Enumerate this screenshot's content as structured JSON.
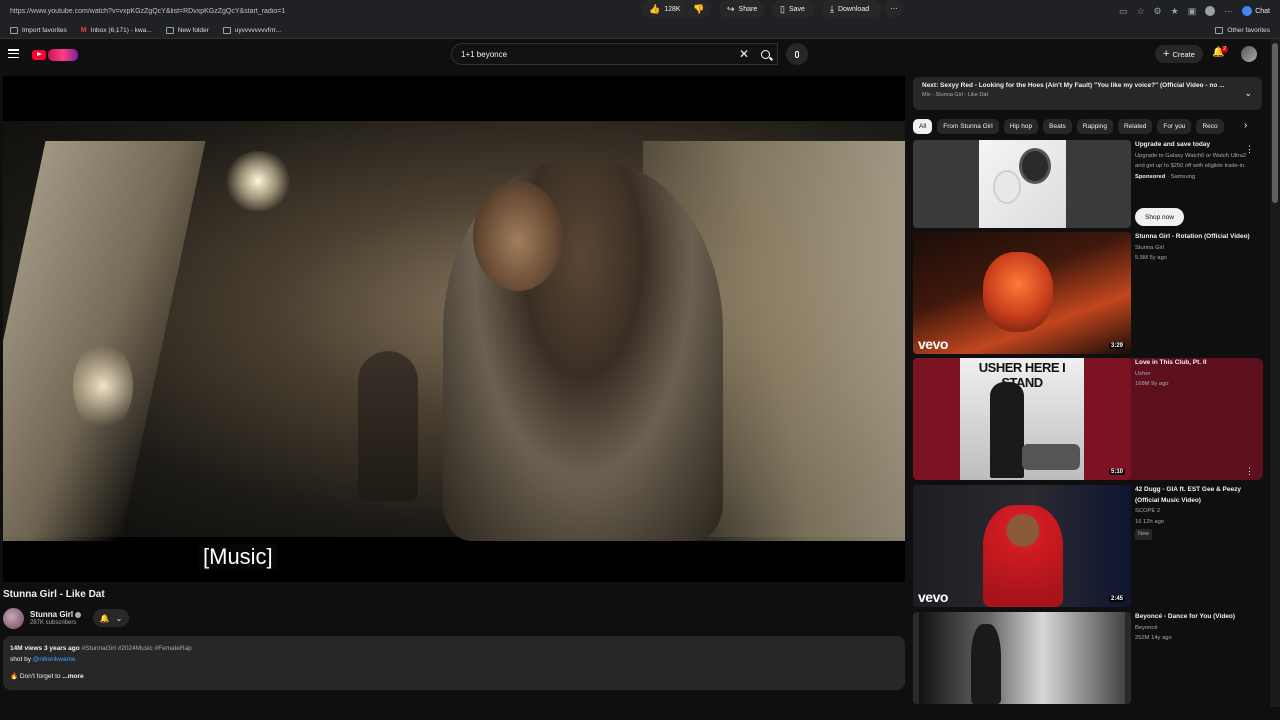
{
  "browser": {
    "url": "https://www.youtube.com/watch?v=vxpKGzZgQcY&list=RDvxpKGzZgQcY&start_radio=1",
    "chat_label": "Chat",
    "bookmarks": [
      {
        "label": "Import favorites"
      },
      {
        "label": "Inbox (6,171) - kwa..."
      },
      {
        "label": "New folder"
      },
      {
        "label": "uyvvvvvvvvfrrr..."
      }
    ],
    "other_favorites": "Other favorites"
  },
  "masthead": {
    "search_value": "1+1 beyonce",
    "create_label": "Create",
    "notification_count": "2"
  },
  "player": {
    "caption": "[Music]"
  },
  "video": {
    "title": "Stunna Girl - Like Dat",
    "channel": "Stunna Girl",
    "subscribers": "287K subscribers",
    "likes": "128K",
    "share_label": "Share",
    "save_label": "Save",
    "download_label": "Download",
    "description": {
      "meta": "14M views  3 years ago",
      "tags": "#StunnaGirl #2024Music #FemaleRap",
      "credit_prefix": "shot by ",
      "credit_link": "@nikonkwame",
      "line": "Don't forget to",
      "more": "...more"
    }
  },
  "up_next": {
    "title": "Next: Sexyy Red - Looking for the Hoes (Ain't My Fault) \"You like my voice?\" (Official Video - no ...",
    "subtitle": "Mix - Stunna Girl - Like Dat"
  },
  "chips": [
    "All",
    "From Stunna Girl",
    "Hip hop",
    "Beats",
    "Rapping",
    "Related",
    "For you",
    "Reco"
  ],
  "ad": {
    "title": "Upgrade and save today",
    "body": "Upgrade to Galaxy Watch6 or Watch Ultra2 and get up to $250 off with eligible trade-in.",
    "sponsored": "Sponsored",
    "advertiser": "· Samsung",
    "cta": "Shop now"
  },
  "recommendations": [
    {
      "title": "Stunna Girl - Rotation (Official Video)",
      "channel": "Stunna Girl",
      "meta": "5.5M  5y ago",
      "duration": "3:29",
      "brand": "vevo"
    },
    {
      "title": "Love in This Club, Pt. II",
      "channel": "Usher",
      "meta": "168M  9y ago",
      "duration": "5:10",
      "thumb_text": "USHER HERE I STAND"
    },
    {
      "title": "42 Dugg - GIA ft. EST Gee & Peezy (Official Music Video)",
      "channel": "SCOPE 2",
      "meta": "16  12h ago",
      "badge": "New",
      "duration": "2:45",
      "brand": "vevo"
    },
    {
      "title": "Beyoncé - Dance for You (Video)",
      "channel": "Beyoncé",
      "meta": "252M  14y ago"
    }
  ]
}
